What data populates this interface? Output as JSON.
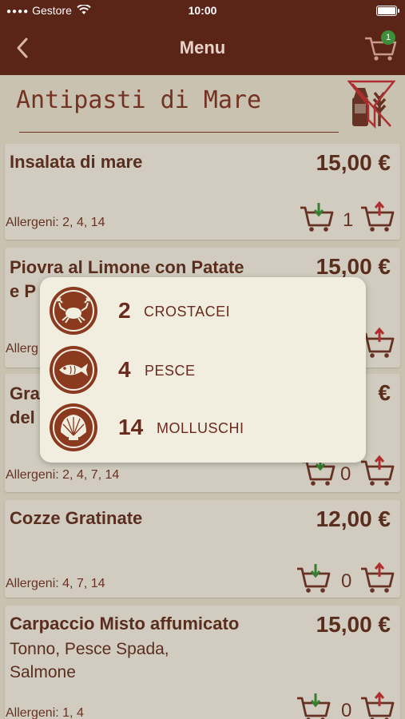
{
  "status_bar": {
    "carrier": "Gestore",
    "time": "10:00"
  },
  "nav": {
    "title": "Menu",
    "cart_count": "1"
  },
  "section": {
    "title": "Antipasti di Mare"
  },
  "items": [
    {
      "name": "Insalata di mare",
      "price": "15,00 €",
      "allergens": "Allergeni: 2, 4, 14",
      "qty": "1"
    },
    {
      "name_line1": "Piovra al Limone con Patate",
      "name_line2": "e P",
      "price": "15,00 €",
      "allergens": "Allerg"
    },
    {
      "name_line1": "Gra",
      "name_line2": "del",
      "price": "€",
      "allergens": "Allergeni: 2, 4, 7, 14",
      "qty": "0"
    },
    {
      "name": "Cozze Gratinate",
      "price": "12,00 €",
      "allergens": "Allergeni: 4, 7, 14",
      "qty": "0"
    },
    {
      "name": "Carpaccio Misto affumicato",
      "desc_line1": "Tonno, Pesce Spada,",
      "desc_line2": "Salmone",
      "price": "15,00 €",
      "allergens": "Allergeni: 1, 4",
      "qty": "0"
    }
  ],
  "allergen_popup": [
    {
      "number": "2",
      "name": "CROSTACEI",
      "icon": "crab-icon"
    },
    {
      "number": "4",
      "name": "PESCE",
      "icon": "fish-icon"
    },
    {
      "number": "14",
      "name": "MOLLUSCHI",
      "icon": "shell-icon"
    }
  ],
  "colors": {
    "brand": "#5a2417",
    "accent_red": "#c0392b",
    "accent_green": "#2e8b2e",
    "background": "#e8e2d3"
  }
}
